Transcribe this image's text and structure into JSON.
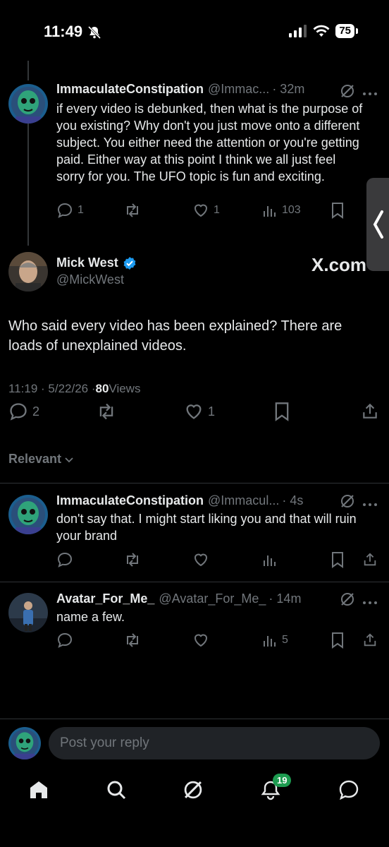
{
  "status": {
    "time": "11:49",
    "battery": "75"
  },
  "parent_post": {
    "name": "ImmaculateConstipation",
    "handle": "@Immac...",
    "time": "· 32m",
    "text": "if every video is debunked, then what is the purpose of you existing? Why don't you just move onto a different subject. You either need the attention or you're getting paid. Either way at this point I think we all just feel sorry for you. The UFO topic is fun and exciting.",
    "replies": "1",
    "likes": "1",
    "views": "103"
  },
  "main_post": {
    "name": "Mick West",
    "handle": "@MickWest",
    "watermark": "X.com",
    "text": "Who said every video has been explained?  There are loads of unexplained videos.",
    "meta_time": "11:19 · 5/22/26 · ",
    "meta_views_count": "80",
    "meta_views_label": " Views",
    "replies": "2",
    "likes": "1"
  },
  "sort": {
    "label": "Relevant"
  },
  "replies": [
    {
      "name": "ImmaculateConstipation",
      "handle": "@Immacul...",
      "time": "· 4s",
      "text": "don't say that. I might start liking you and that will ruin your brand"
    },
    {
      "name": "Avatar_For_Me_",
      "handle": "@Avatar_For_Me_",
      "time": "· 14m",
      "text": "name a few.",
      "views": "5"
    }
  ],
  "composer": {
    "placeholder": "Post your reply"
  },
  "nav": {
    "notifications_badge": "19"
  },
  "colors": {
    "verified": "#1d9bf0",
    "badge": "#1d9b50",
    "muted": "#71767b"
  }
}
